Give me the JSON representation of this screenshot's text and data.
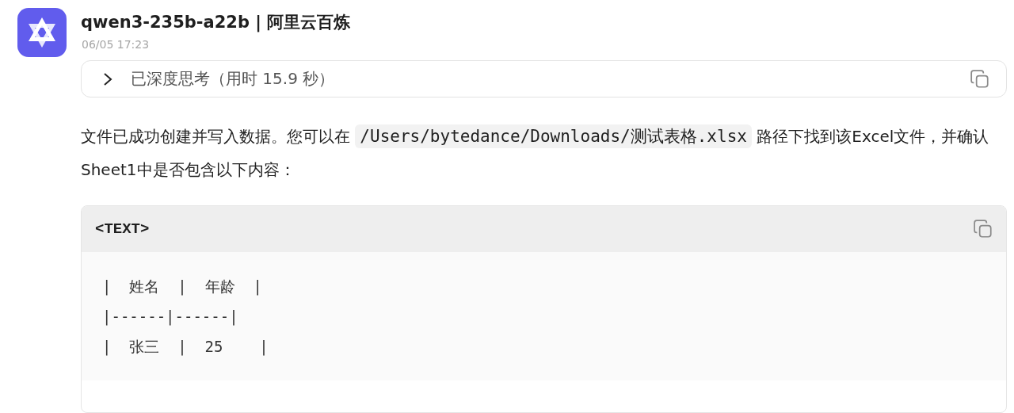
{
  "message": {
    "sender": "qwen3-235b-a22b | 阿里云百炼",
    "time": "06/05 17:23"
  },
  "thinking": {
    "label": "已深度思考（用时 15.9 秒）",
    "expanded": false
  },
  "answer": {
    "text_before": "文件已成功创建并写入数据。您可以在 ",
    "code": "/Users/bytedance/Downloads/测试表格.xlsx",
    "text_after": " 路径下找到该Excel文件，并确认Sheet1中是否包含以下内容："
  },
  "code_block": {
    "language": "<TEXT>",
    "lines": [
      "|  姓名  |  年龄  |",
      "|------|------|",
      "|  张三  |  25    |"
    ]
  }
}
